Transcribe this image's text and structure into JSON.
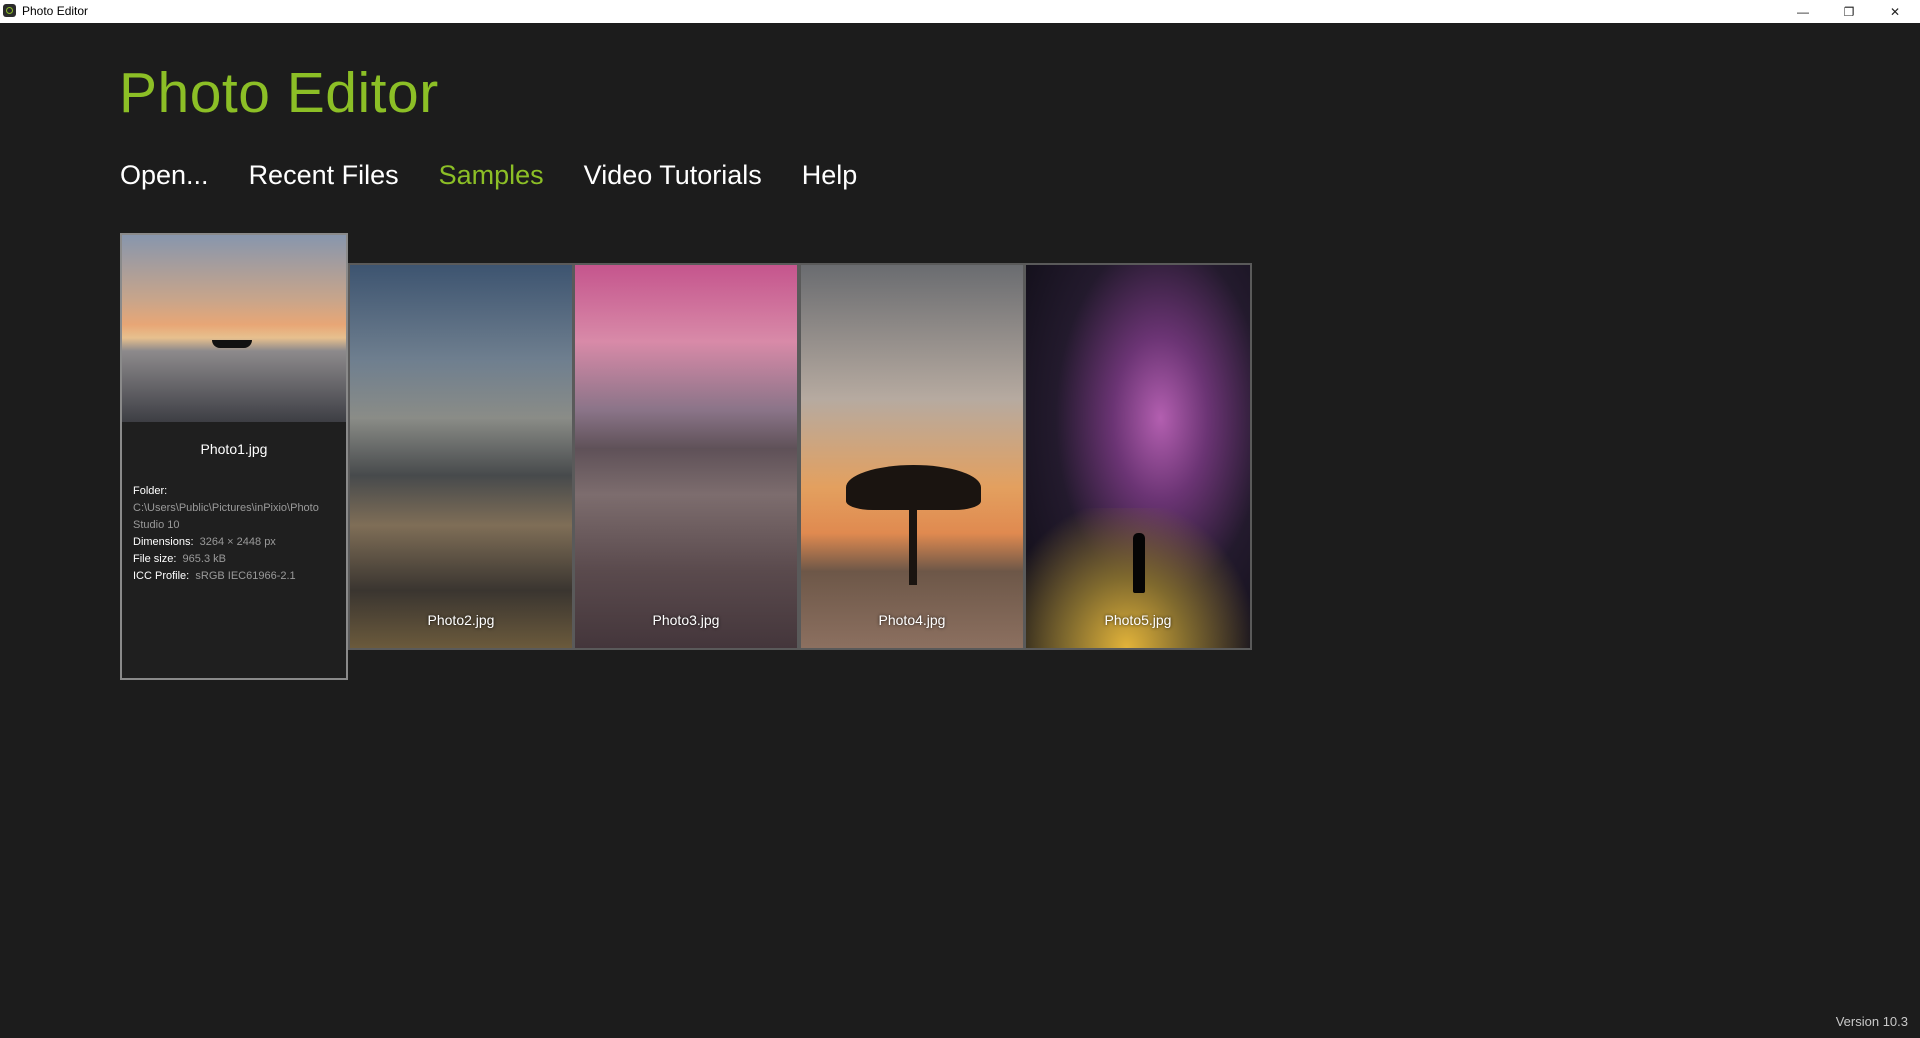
{
  "window": {
    "title": "Photo Editor",
    "controls": {
      "minimize": "—",
      "maximize": "❐",
      "close": "✕"
    }
  },
  "app": {
    "title": "Photo Editor",
    "accent_color": "#8cbf26"
  },
  "nav": [
    {
      "label": "Open...",
      "active": false
    },
    {
      "label": "Recent Files",
      "active": false
    },
    {
      "label": "Samples",
      "active": true
    },
    {
      "label": "Video Tutorials",
      "active": false
    },
    {
      "label": "Help",
      "active": false
    }
  ],
  "samples": [
    {
      "name": "Photo1.jpg",
      "selected": true,
      "info": {
        "folder_label": "Folder:",
        "folder": "C:\\Users\\Public\\Pictures\\inPixio\\Photo Studio 10",
        "dimensions_label": "Dimensions:",
        "dimensions": "3264 × 2448 px",
        "filesize_label": "File size:",
        "filesize": "965.3 kB",
        "icc_label": "ICC Profile:",
        "icc": "sRGB IEC61966-2.1"
      }
    },
    {
      "name": "Photo2.jpg"
    },
    {
      "name": "Photo3.jpg"
    },
    {
      "name": "Photo4.jpg"
    },
    {
      "name": "Photo5.jpg"
    }
  ],
  "footer": {
    "version": "Version 10.3"
  }
}
